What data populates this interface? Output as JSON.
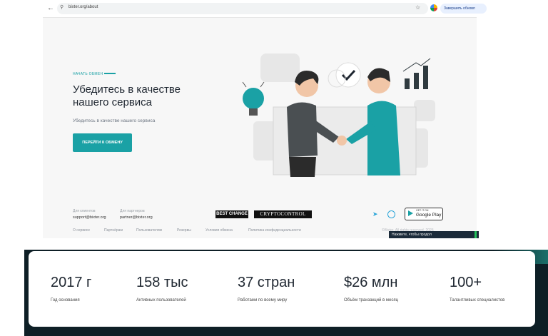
{
  "browser": {
    "url": "bixter.org/about",
    "update_button": "Завершить обновл"
  },
  "hero": {
    "kicker": "НАЧАТЬ ОБМЕН",
    "title_line1": "Убедитесь в качестве",
    "title_line2": "нашего сервиса",
    "subtitle": "Убедитесь в качестве нашего сервиса",
    "cta": "ПЕРЕЙТИ К ОБМЕНУ"
  },
  "footer": {
    "users_label": "Для клиентов",
    "users_email": "support@bixter.org",
    "partners_label": "Для партнеров",
    "partners_email": "partner@bixter.org",
    "logo_bestchange": "BEST CHANGE",
    "logo_cryptocontrol": "CRYPTOCONTROL",
    "gplay_small": "GET IT ON",
    "gplay_big": "Google Play",
    "links": [
      "О сервисе",
      "Партнёрам",
      "Пользователям",
      "Резервы",
      "Условия обмена",
      "Политика конфиденциальности"
    ],
    "copyright": "©Bixter. All rights reserved. 2025",
    "toast": "Нажмите, чтобы продол"
  },
  "stats": [
    {
      "value": "2017 г",
      "label": "Год основания"
    },
    {
      "value": "158 тыс",
      "label": "Активных пользователей"
    },
    {
      "value": "37 стран",
      "label": "Работаем по всему миру"
    },
    {
      "value": "$26 млн",
      "label": "Объём транзакций в месяц"
    },
    {
      "value": "100+",
      "label": "Талантливых специалистов"
    }
  ],
  "colors": {
    "accent": "#1aa1a5",
    "text": "#1e2630",
    "band": "#0e1f26"
  },
  "icons": [
    "back-icon",
    "forward-icon",
    "reload-icon",
    "site-info-icon",
    "bookmark-star-icon",
    "extension-icon",
    "telegram-icon",
    "whatsapp-icon",
    "google-play-icon"
  ]
}
